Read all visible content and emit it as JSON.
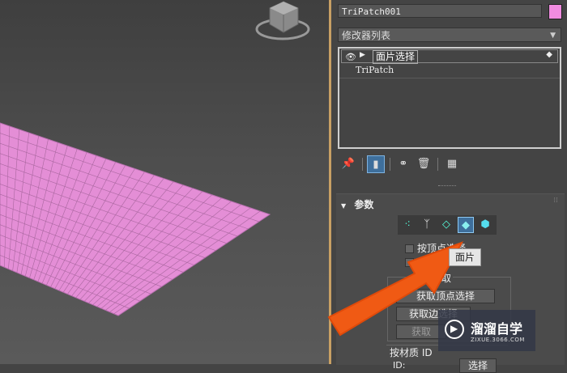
{
  "command_panel": {
    "object_name": "TriPatch001",
    "object_color": "#f08ce0",
    "modifier_list_label": "修改器列表",
    "stack": {
      "selected_modifier": "面片选择",
      "base_object": "TriPatch"
    },
    "toolbar_icons": [
      "pin-icon",
      "show-end-result-icon",
      "make-unique-icon",
      "remove-modifier-icon",
      "configure-modifier-sets-icon"
    ]
  },
  "parameters": {
    "title": "参数",
    "subobject_levels": [
      "vertex-icon",
      "handle-icon",
      "edge-icon",
      "patch-icon",
      "element-icon"
    ],
    "active_level": "patch-icon",
    "by_vertex_label": "按顶点选择",
    "ignore_backfaces_partial": "t",
    "get_from_partial": "获取",
    "get_vertex_btn": "获取顶点选择",
    "get_edge_btn": "获取边选择",
    "get_patch_btn": "获取",
    "by_material_label": "按材质 ID",
    "id_label": "ID:",
    "select_btn": "选择"
  },
  "tooltip": "面片",
  "accent_color": "#3e6f9c",
  "watermark": {
    "title": "溜溜自学",
    "subtitle": "ZIXUE.3066.COM"
  }
}
